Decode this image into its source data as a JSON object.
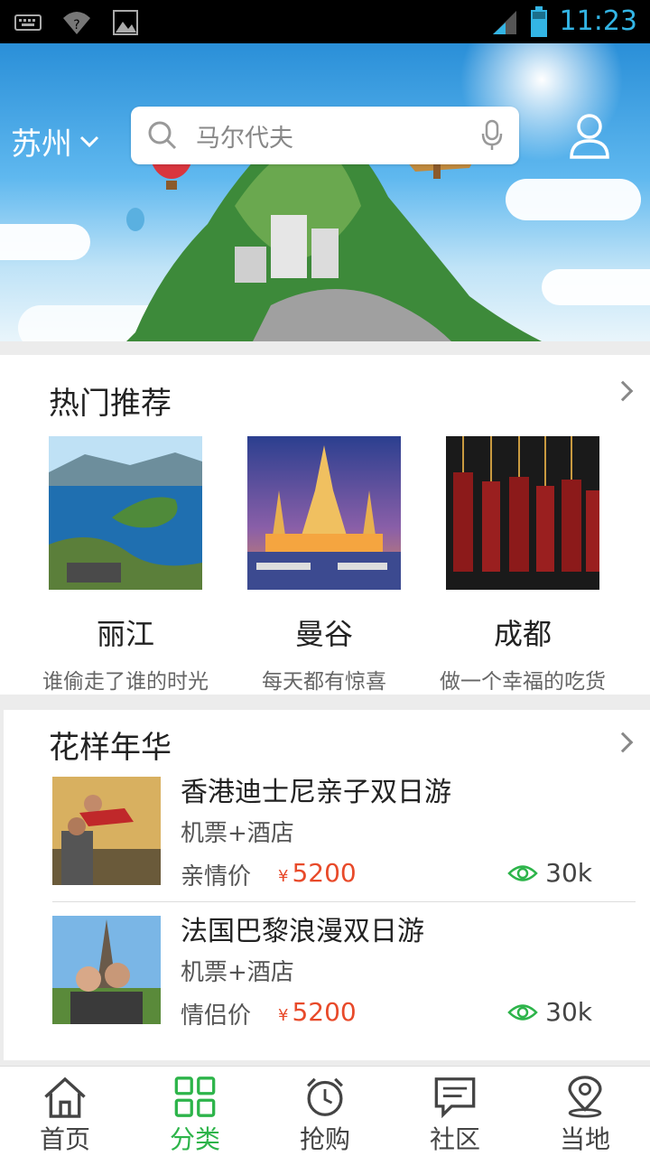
{
  "status_bar": {
    "time": "11:23",
    "icons": [
      "keyboard-icon",
      "wifi-alert-icon",
      "image-icon",
      "signal-icon",
      "battery-icon"
    ]
  },
  "banner": {
    "city": "苏州",
    "search_placeholder": "马尔代夫",
    "icons": [
      "chevron-down-icon",
      "search-icon",
      "microphone-icon",
      "user-icon"
    ]
  },
  "hot": {
    "title": "热门推荐",
    "items": [
      {
        "name": "丽江",
        "desc": "谁偷走了谁的时光"
      },
      {
        "name": "曼谷",
        "desc": "每天都有惊喜"
      },
      {
        "name": "成都",
        "desc": "做一个幸福的吃货"
      }
    ]
  },
  "fancy": {
    "title": "花样年华",
    "trips": [
      {
        "title": "香港迪士尼亲子双日游",
        "sub": "机票+酒店",
        "kind": "亲情价",
        "currency": "¥",
        "price": "5200",
        "views": "30k"
      },
      {
        "title": "法国巴黎浪漫双日游",
        "sub": "机票+酒店",
        "kind": "情侣价",
        "currency": "¥",
        "price": "5200",
        "views": "30k"
      }
    ]
  },
  "nav": {
    "items": [
      {
        "label": "首页",
        "icon": "home-icon"
      },
      {
        "label": "分类",
        "icon": "grid-icon"
      },
      {
        "label": "抢购",
        "icon": "alarm-clock-icon"
      },
      {
        "label": "社区",
        "icon": "chat-icon"
      },
      {
        "label": "当地",
        "icon": "location-pin-icon"
      }
    ],
    "active_index": 1
  },
  "colors": {
    "accent": "#2db44a",
    "price": "#e84a2a",
    "status_bar": "#000000",
    "status_icon": "#33b5e5"
  }
}
